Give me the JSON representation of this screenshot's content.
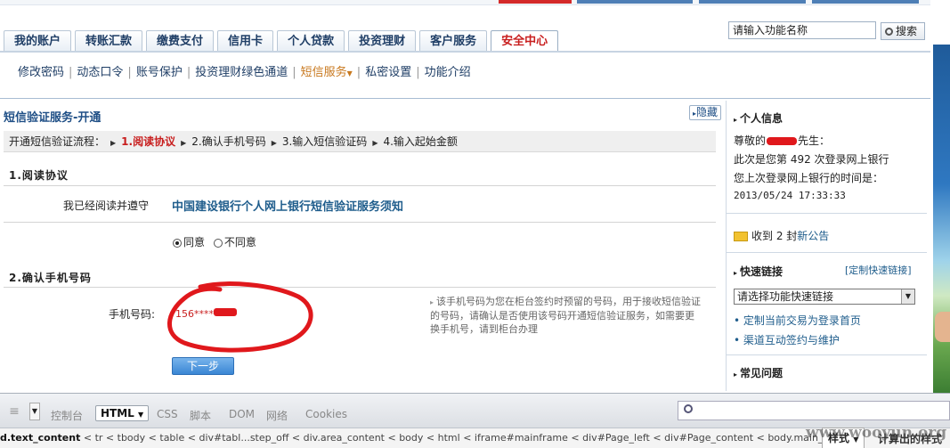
{
  "tabs": [
    {
      "label": "我的账户"
    },
    {
      "label": "转账汇款"
    },
    {
      "label": "缴费支付"
    },
    {
      "label": "信用卡"
    },
    {
      "label": "个人贷款"
    },
    {
      "label": "投资理财"
    },
    {
      "label": "客户服务"
    },
    {
      "label": "安全中心",
      "active": true
    }
  ],
  "search": {
    "value": "请输入功能名称",
    "button_label": "搜索"
  },
  "subnav": [
    {
      "label": "修改密码"
    },
    {
      "label": "动态口令"
    },
    {
      "label": "账号保护"
    },
    {
      "label": "投资理财绿色通道"
    },
    {
      "label": "短信服务",
      "current": true
    },
    {
      "label": "私密设置"
    },
    {
      "label": "功能介绍"
    }
  ],
  "main": {
    "title": "短信验证服务-开通",
    "hide_label": "隐藏",
    "flow_label": "开通短信验证流程：",
    "steps": [
      "1.阅读协议",
      "2.确认手机号码",
      "3.输入短信验证码",
      "4.输入起始金额"
    ],
    "section1_title": "1.阅读协议",
    "agree_prefix": "我已经阅读并遵守",
    "agreement_link": "中国建设银行个人网上银行短信验证服务须知",
    "radio_agree": "同意",
    "radio_disagree": "不同意",
    "section2_title": "2.确认手机号码",
    "phone_label": "手机号码:",
    "phone_value": "156****",
    "note": "该手机号码为您在柜台签约时预留的号码，用于接收短信验证的号码，请确认是否使用该号码开通短信验证服务，如需要更换手机号，请到柜台办理",
    "next_label": "下一步"
  },
  "sidebar": {
    "info_title": "个人信息",
    "greeting_prefix": "尊敬的",
    "greeting_suffix": "先生：",
    "login_count_text": "此次是您第 492 次登录网上银行",
    "last_login_label": "您上次登录网上银行的时间是：",
    "last_login_time": "2013/05/24 17:33:33",
    "mail_prefix": "收到 2 封",
    "mail_link": "新公告",
    "quick_title": "快速链接",
    "quick_custom": "[定制快速链接]",
    "quick_select": "请选择功能快速链接",
    "links": [
      "定制当前交易为登录首页",
      "渠道互动签约与维护"
    ],
    "faq_title": "常见问题"
  },
  "devtools": {
    "tabs": [
      "控制台",
      "HTML",
      "CSS",
      "脚本",
      "DOM",
      "网络",
      "Cookies"
    ],
    "active_tab": "HTML",
    "crumb_first": "d.text_content",
    "crumbs": [
      "tr",
      "tbody",
      "table",
      "div#tabl...step_off",
      "div.area_content",
      "body",
      "html",
      "iframe#mainframe",
      "div#Page_left",
      "div#Page_content",
      "body.main_body"
    ],
    "style_tab": "样式",
    "computed": "计算出的样式"
  },
  "watermark": "www.wooyun.org"
}
